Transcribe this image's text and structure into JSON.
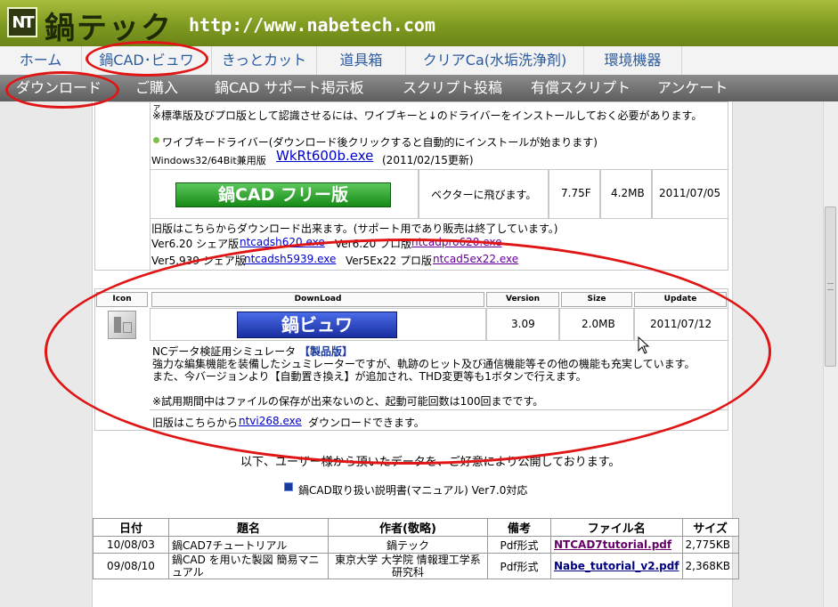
{
  "header": {
    "logo_mark": "NT",
    "logo_text": "鍋テック",
    "url": "http://www.nabetech.com"
  },
  "nav1": [
    {
      "label": "ホーム"
    },
    {
      "label": "鍋CAD･ビュワ"
    },
    {
      "label": "きっとカット"
    },
    {
      "label": "道具箱"
    },
    {
      "label": "クリアCa(水垢洗浄剤)"
    },
    {
      "label": "環境機器"
    }
  ],
  "nav2": [
    {
      "label": "ダウンロード"
    },
    {
      "label": "ご購入"
    },
    {
      "label": "鍋CAD サポート掲示板"
    },
    {
      "label": "スクリプト投稿"
    },
    {
      "label": "有償スクリプト"
    },
    {
      "label": "アンケート"
    }
  ],
  "cad_section": {
    "note_fragment": "ァ",
    "note": "※標準版及びプロ版として認識させるには、ワイブキーと↓のドライバーをインストールしておく必要があります。",
    "driver_title": "ワイブキードライバー(ダウンロード後クリックすると自動的にインストールが始まります)",
    "driver_os": "Windows32/64Bit兼用版",
    "driver_file": "WkRt600b.exe",
    "driver_date": "(2011/02/15更新)",
    "free_button": "鍋CAD フリー版",
    "vector_text": "ベクターに飛びます。",
    "version": "7.75F",
    "size": "4.2MB",
    "update": "2011/07/05",
    "old_note": "旧版はこちらからダウンロード出来ます。(サポート用であり販売は終了しています。)",
    "old1_label": "Ver6.20 シェア版",
    "old1_file": "ntcadsh620.exe",
    "old2_label": "Ver6.20 プロ版",
    "old2_file": "ntcadpro620.exe",
    "old3_label": "Ver5.939 シェア版",
    "old3_file": "ntcadsh5939.exe",
    "old4_label": "Ver5Ex22 プロ版",
    "old4_file": "ntcad5ex22.exe"
  },
  "viewer_section": {
    "headers": {
      "icon": "Icon",
      "download": "DownLoad",
      "version": "Version",
      "size": "Size",
      "update": "Update"
    },
    "button": "鍋ビュワ",
    "version": "3.09",
    "size": "2.0MB",
    "update": "2011/07/12",
    "desc1": "NCデータ検証用シミュレータ",
    "desc1_badge": "【製品版】",
    "desc2": "強力な編集機能を装備したシュミレーターですが、軌跡のヒット及び通信機能等その他の機能も充実しています。",
    "desc3": "また、今バージョンより【自動置き換え】が追加され、THD変更等も1ボタンで行えます。",
    "desc4": "※試用期間中はファイルの保存が出来ないのと、起動可能回数は100回までです。",
    "old_prefix": "旧版はこちらから",
    "old_file": "ntvi268.exe",
    "old_suffix": "ダウンロードできます。"
  },
  "user_data": {
    "intro": "以下、ユーザー様から頂いたデータを、ご好意により公開しております。",
    "manual_link": "鍋CAD取り扱い説明書(マニュアル) Ver7.0対応",
    "columns": [
      "日付",
      "題名",
      "作者(敬略)",
      "備考",
      "ファイル名",
      "サイズ"
    ],
    "rows": [
      {
        "date": "10/08/03",
        "title": "鍋CAD7チュートリアル",
        "author": "鍋テック",
        "note": "Pdf形式",
        "file": "NTCAD7tutorial.pdf",
        "size": "2,775KB"
      },
      {
        "date": "09/08/10",
        "title": "鍋CAD を用いた製図 簡易マニュアル",
        "author": "東京大学 大学院 情報理工学系研究科",
        "note": "Pdf形式",
        "file": "Nabe_tutorial_v2.pdf",
        "size": "2,368KB"
      }
    ]
  },
  "colors": {
    "highlight": "#e01515",
    "nav_link": "#2a5aa0",
    "header_green": "#8aa52a"
  }
}
